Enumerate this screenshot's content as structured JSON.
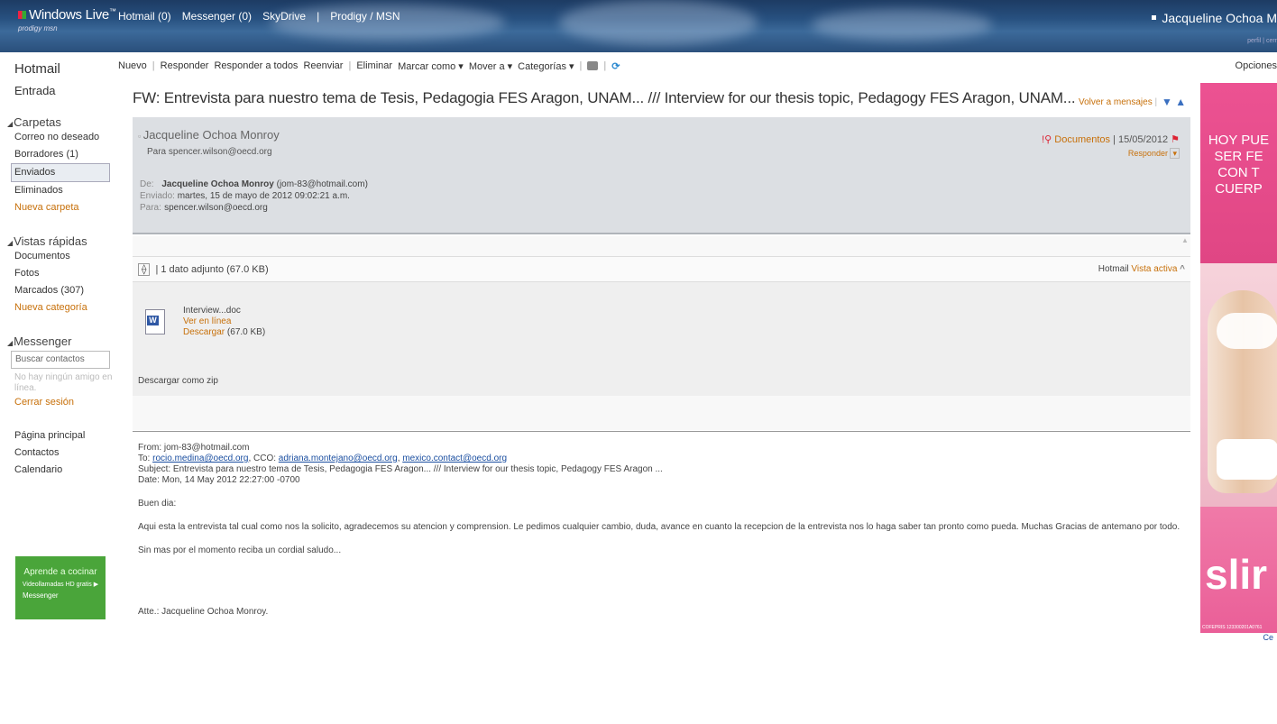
{
  "header": {
    "brand": "Windows Live",
    "brand_sub": "prodigy msn",
    "links": [
      "Hotmail (0)",
      "Messenger (0)",
      "SkyDrive",
      "|",
      "Prodigy / MSN"
    ],
    "user": "Jacqueline Ochoa M",
    "perfil": "perfil | cerr"
  },
  "sidebar": {
    "title": "Hotmail",
    "inbox": "Entrada",
    "folders_title": "Carpetas",
    "folders": [
      "Correo no deseado",
      "Borradores (1)",
      "Enviados",
      "Eliminados"
    ],
    "new_folder": "Nueva carpeta",
    "quick_title": "Vistas rápidas",
    "quick": [
      "Documentos",
      "Fotos",
      "Marcados (307)"
    ],
    "new_category": "Nueva categoría",
    "messenger_title": "Messenger",
    "search_placeholder": "Buscar contactos",
    "no_friends": "No hay ningún amigo en línea.",
    "logout": "Cerrar sesión",
    "links": [
      "Página principal",
      "Contactos",
      "Calendario"
    ],
    "ad_line1": "Aprende a cocinar",
    "ad_line2": "Videollamadas HD gratis ▶",
    "ad_line3": "Messenger"
  },
  "toolbar": {
    "items": [
      "Nuevo",
      "Responder",
      "Responder a todos",
      "Reenviar",
      "Eliminar",
      "Marcar como ▾",
      "Mover a ▾",
      "Categorías ▾"
    ],
    "options": "Opciones"
  },
  "message": {
    "subject": "FW: Entrevista para nuestro tema de Tesis, Pedagogia FES Aragon, UNAM... /// Interview for our thesis topic, Pedagogy FES Aragon, UNAM...",
    "back": "Volver a mensajes",
    "from_name": "Jacqueline Ochoa Monroy",
    "to_line": "Para spencer.wilson@oecd.org",
    "category": "Documentos",
    "date": "| 15/05/2012",
    "reply": "Responder",
    "de_label": "De:",
    "de_name": "Jacqueline Ochoa Monroy",
    "de_email": "(jom-83@hotmail.com)",
    "enviado_label": "Enviado:",
    "enviado": "martes, 15 de mayo de 2012 09:02:21 a.m.",
    "para_label": "Para:",
    "para": "spencer.wilson@oecd.org"
  },
  "attachments": {
    "summary": "1 dato adjunto (67.0 KB)",
    "hotmail": "Hotmail",
    "active_view": "Vista activa",
    "filename": "Interview...doc",
    "view_online": "Ver en línea",
    "download": "Descargar",
    "download_size": "(67.0 KB)",
    "zip": "Descargar como zip"
  },
  "body": {
    "from": "From: jom-83@hotmail.com",
    "to_prefix": "To:",
    "to_email": "rocio.medina@oecd.org",
    "cco_prefix": ", CCO:",
    "cco1": "adriana.montejano@oecd.org",
    "cco2": "mexico.contact@oecd.org",
    "subject": "Subject: Entrevista para nuestro tema de Tesis, Pedagogia FES Aragon... /// Interview for our thesis topic, Pedagogy FES Aragon ...",
    "date": "Date: Mon, 14 May 2012 22:27:00 -0700",
    "greeting": "Buen dia:",
    "paragraph": "Aqui esta la entrevista tal cual como nos la solicito, agradecemos su atencion y comprension. Le pedimos cualquier cambio, duda, avance en cuanto la recepcion de la entrevista nos lo haga saber tan pronto como pueda. Muchas Gracias de antemano por todo.",
    "closing": "Sin mas por el momento reciba un cordial saludo...",
    "signature": "Atte.: Jacqueline Ochoa Monroy."
  },
  "ad": {
    "text1": "HOY PUE",
    "text2": "SER FE",
    "text3": "CON T",
    "text4": "CUERP",
    "brand": "slir",
    "fine": "COFEPRIS 123300201A0761",
    "link": "Ce"
  },
  "colors": {
    "accent_orange": "#c7700a",
    "link_blue": "#1a4ea0",
    "header_bg": "#27507f"
  }
}
